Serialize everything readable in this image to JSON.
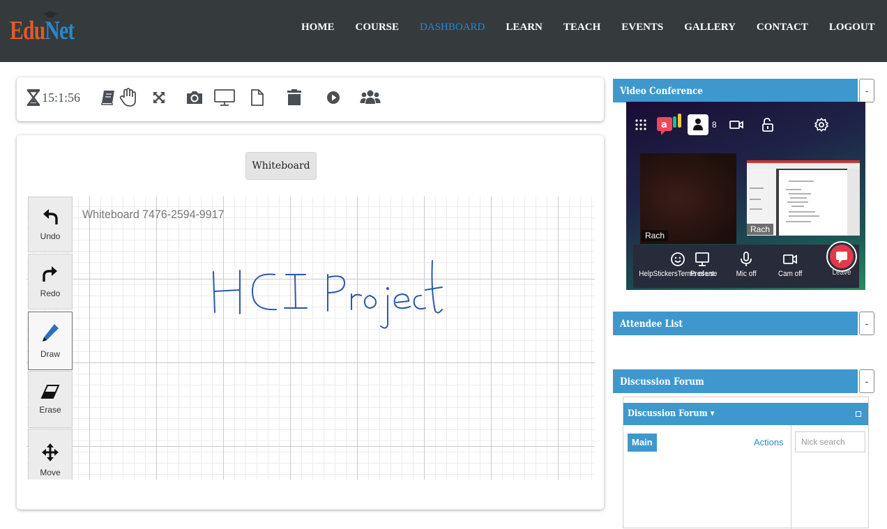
{
  "header": {
    "logo_part1": "Edu",
    "logo_part2": "Net",
    "nav": [
      "HOME",
      "COURSE",
      "DASHBOARD",
      "LEARN",
      "TEACH",
      "EVENTS",
      "GALLERY",
      "CONTACT",
      "LOGOUT"
    ],
    "active_nav": "DASHBOARD",
    "colors": {
      "bg": "#353a3d",
      "active": "#2a86c8",
      "logo_edu": "#e05b2a",
      "logo_net": "#2a86c8"
    }
  },
  "toolbar": {
    "timer": "15:1:56",
    "icons": [
      "hourglass-icon",
      "book-icon",
      "hand-icon",
      "expand-icon",
      "camera-icon",
      "monitor-icon",
      "file-icon",
      "trash-icon",
      "play-icon",
      "users-icon"
    ]
  },
  "whiteboard": {
    "button_label": "Whiteboard",
    "board_id": "Whiteboard 7476-2594-9917",
    "handwritten_text": "HCI Project",
    "tools": [
      {
        "label": "Undo",
        "icon": "undo-icon"
      },
      {
        "label": "Redo",
        "icon": "redo-icon"
      },
      {
        "label": "Draw",
        "icon": "pencil-icon",
        "selected": true
      },
      {
        "label": "Erase",
        "icon": "eraser-icon"
      },
      {
        "label": "Move",
        "icon": "move-icon"
      }
    ]
  },
  "video_conference": {
    "title": "Video Conference",
    "collapse_label": "-",
    "participant_count": "8",
    "tiles": [
      "Rach",
      "Rach"
    ],
    "controls": [
      {
        "label": "HelpStickersTerms of use",
        "icon": "smiley-icon"
      },
      {
        "label": "Present",
        "icon": "present-icon"
      },
      {
        "label": "Mic off",
        "icon": "mic-icon"
      },
      {
        "label": "Cam off",
        "icon": "cam-icon"
      },
      {
        "label": "Leave",
        "icon": "leave-icon"
      }
    ]
  },
  "attendee_list": {
    "title": "Attendee List",
    "collapse_label": "-"
  },
  "discussion_forum": {
    "title": "Discussion Forum",
    "collapse_label": "-",
    "inner_title": "Discussion Forum ▾",
    "main_tab": "Main",
    "actions": "Actions",
    "nick_search_placeholder": "Nick search"
  }
}
